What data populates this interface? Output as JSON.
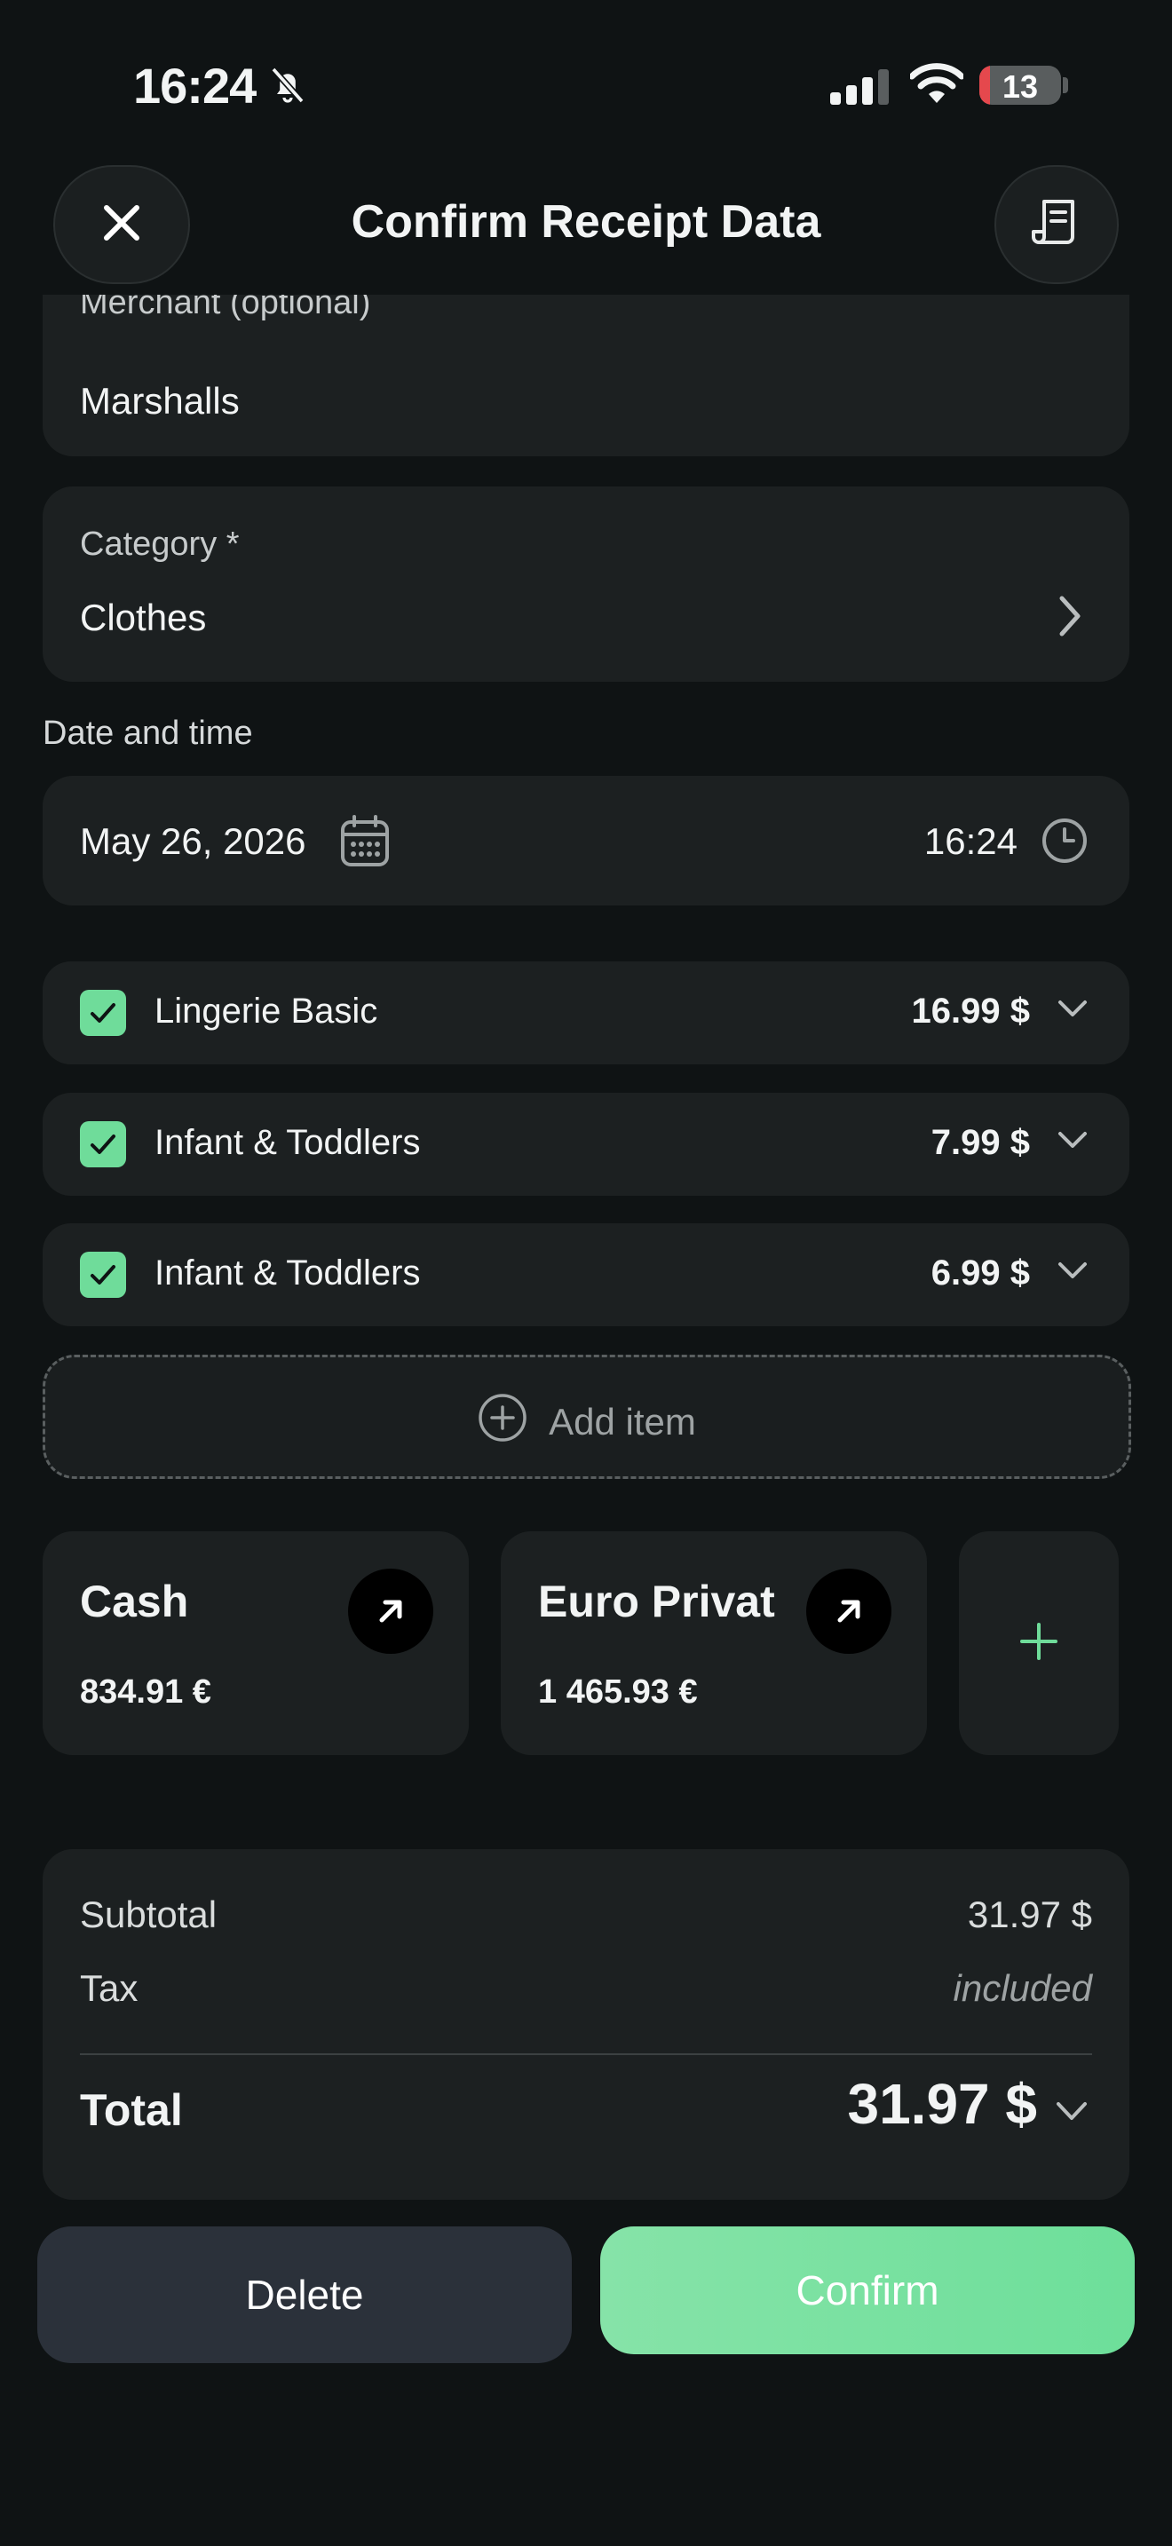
{
  "status_bar": {
    "time": "16:24",
    "battery": "13",
    "battery_level": 0.13
  },
  "header": {
    "title": "Confirm Receipt Data",
    "close_icon": "close-icon",
    "receipt_icon": "receipt-icon"
  },
  "merchant": {
    "label": "Merchant (optional)",
    "value": "Marshalls"
  },
  "category": {
    "label": "Category *",
    "value": "Clothes"
  },
  "datetime": {
    "label": "Date and time",
    "date": "May 26, 2026",
    "time": "16:24"
  },
  "items": [
    {
      "name": "Lingerie Basic",
      "price": "16.99 $",
      "checked": true
    },
    {
      "name": "Infant & Toddlers",
      "price": "7.99 $",
      "checked": true
    },
    {
      "name": "Infant & Toddlers",
      "price": "6.99 $",
      "checked": true
    }
  ],
  "add_item": {
    "label": "Add item"
  },
  "accounts": [
    {
      "name": "Cash",
      "balance": "834.91 €"
    },
    {
      "name": "Euro Privat",
      "balance": "1 465.93 €"
    }
  ],
  "summary": {
    "subtotal_label": "Subtotal",
    "subtotal_value": "31.97 $",
    "tax_label": "Tax",
    "tax_value": "included",
    "total_label": "Total",
    "total_value": "31.97 $"
  },
  "actions": {
    "delete": "Delete",
    "confirm": "Confirm"
  },
  "colors": {
    "accent": "#6fdc9a",
    "background": "#0f1314",
    "card": "#1c2021",
    "battery_low": "#e5484d"
  }
}
